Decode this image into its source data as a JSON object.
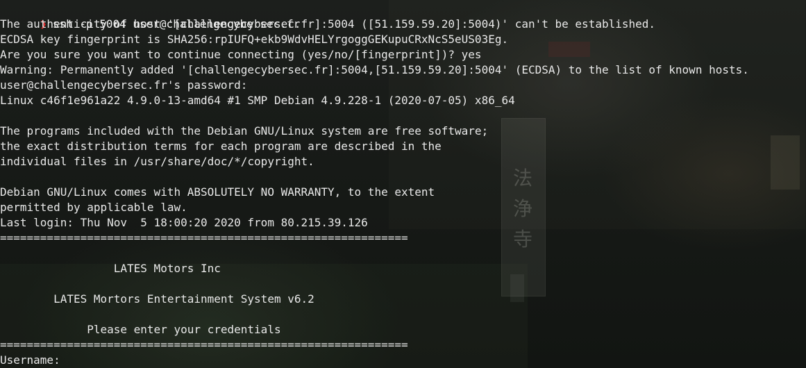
{
  "terminal": {
    "prompt_symbol": "❯",
    "command": "ssh -p 5004 user@challengecybersec.fr",
    "output": [
      "The authenticity of host '[challengecybersec.fr]:5004 ([51.159.59.20]:5004)' can't be established.",
      "ECDSA key fingerprint is SHA256:rpIUFQ+ekb9WdvHELYrgoggGEKupuCRxNcS5eUS03Eg.",
      "Are you sure you want to continue connecting (yes/no/[fingerprint])? yes",
      "Warning: Permanently added '[challengecybersec.fr]:5004,[51.159.59.20]:5004' (ECDSA) to the list of known hosts.",
      "user@challengecybersec.fr's password:",
      "Linux c46f1e961a22 4.9.0-13-amd64 #1 SMP Debian 4.9.228-1 (2020-07-05) x86_64",
      "",
      "The programs included with the Debian GNU/Linux system are free software;",
      "the exact distribution terms for each program are described in the",
      "individual files in /usr/share/doc/*/copyright.",
      "",
      "Debian GNU/Linux comes with ABSOLUTELY NO WARRANTY, to the extent",
      "permitted by applicable law.",
      "Last login: Thu Nov  5 18:00:20 2020 from 80.215.39.126",
      "=============================================================",
      "",
      "                 LATES Motors Inc",
      "",
      "        LATES Mortors Entertainment System v6.2",
      "",
      "             Please enter your credentials",
      "=============================================================",
      "Username:"
    ]
  },
  "wallpaper": {
    "sign_glyph": "法浄寺"
  },
  "colors": {
    "prompt_arrow": "#e53030",
    "text": "#e9e9e9",
    "background": "#151815"
  }
}
